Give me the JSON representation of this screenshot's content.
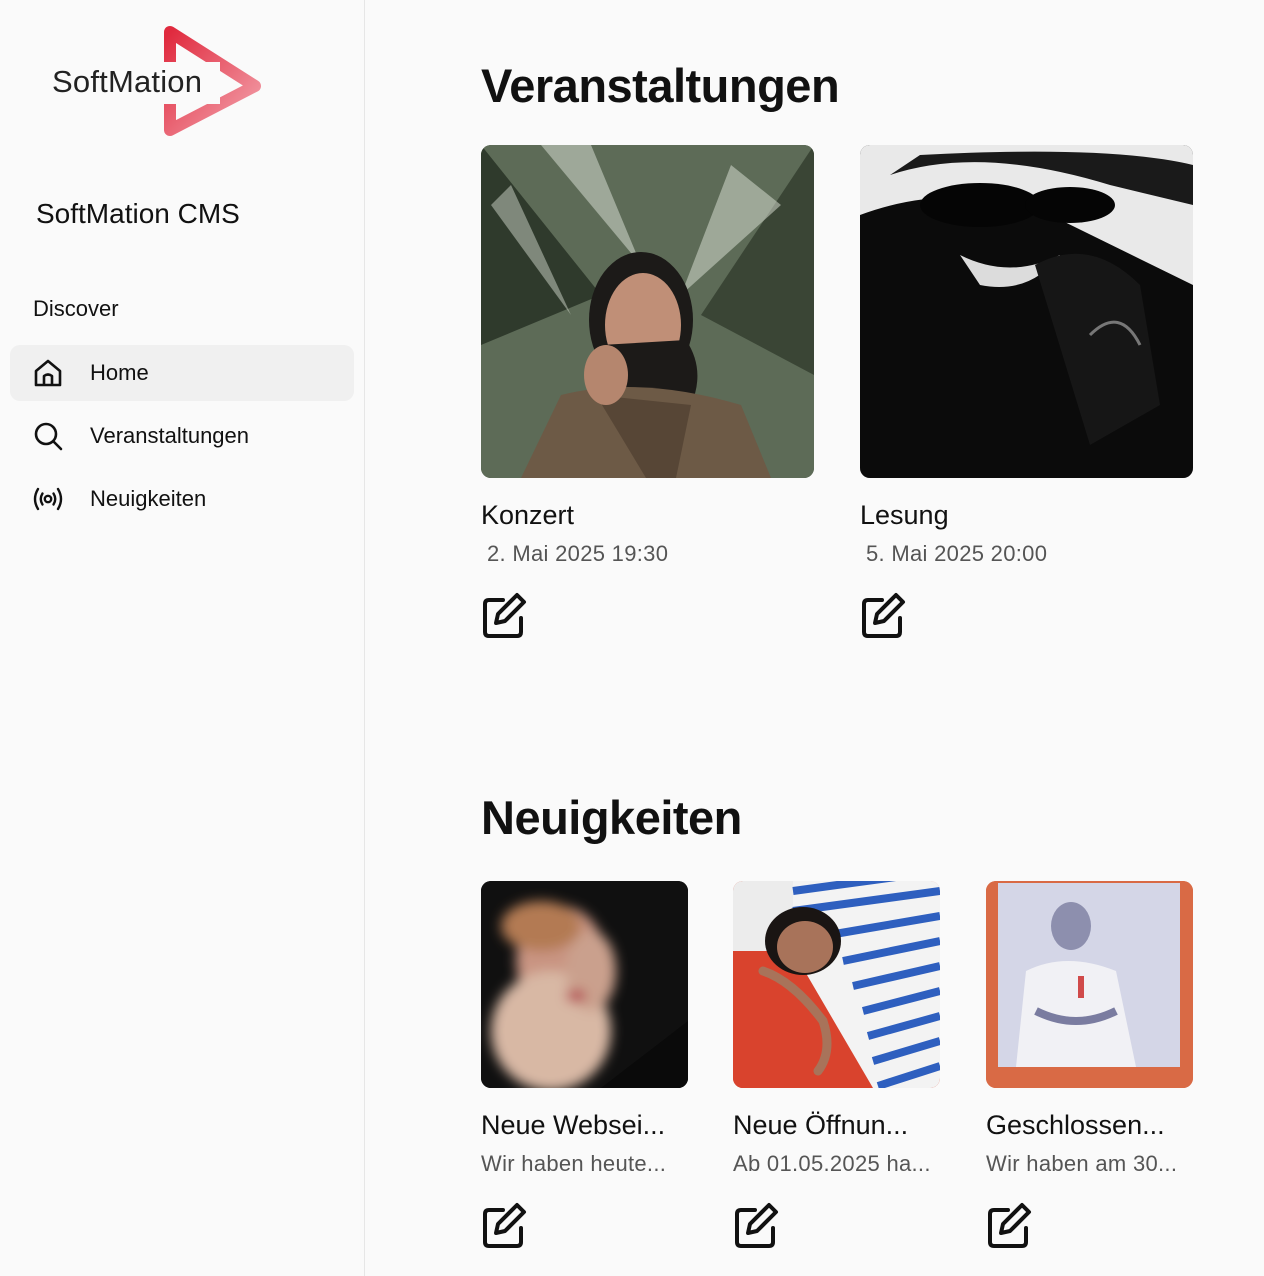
{
  "brand": {
    "logo_text": "SoftMation",
    "app_title": "SoftMation CMS"
  },
  "sidebar": {
    "section": "Discover",
    "items": [
      {
        "label": "Home",
        "icon": "home-icon",
        "active": true
      },
      {
        "label": "Veranstaltungen",
        "icon": "search-icon",
        "active": false
      },
      {
        "label": "Neuigkeiten",
        "icon": "broadcast-icon",
        "active": false
      }
    ]
  },
  "events": {
    "heading": "Veranstaltungen",
    "items": [
      {
        "title": "Konzert",
        "date": "2. Mai 2025 19:30",
        "image": "woman-among-palm-leaves-photo"
      },
      {
        "title": "Lesung",
        "date": "5. Mai 2025 20:00",
        "image": "bw-woman-sunglasses-photo"
      }
    ]
  },
  "news": {
    "heading": "Neuigkeiten",
    "items": [
      {
        "title": "Neue Websei...",
        "excerpt": "Wir haben heute...",
        "image": "blurred-woman-portrait-photo"
      },
      {
        "title": "Neue Öffnun...",
        "excerpt": "Ab 01.05.2025 ha...",
        "image": "woman-striped-shirt-photo"
      },
      {
        "title": "Geschlossen...",
        "excerpt": "Wir haben am 30...",
        "image": "polaroid-man-portrait-photo"
      }
    ]
  },
  "colors": {
    "accent": "#e23b4f",
    "accent_light": "#f19aa5",
    "active_bg": "#f0f0f0"
  }
}
